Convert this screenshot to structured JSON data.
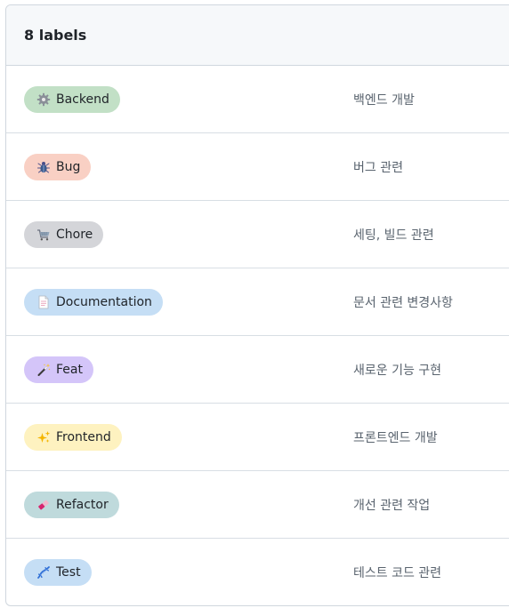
{
  "header": {
    "count_label": "8 labels"
  },
  "labels": [
    {
      "name": "Backend",
      "icon": "gear-icon",
      "color": "#c2e0c6",
      "description": "백엔드 개발"
    },
    {
      "name": "Bug",
      "icon": "bug-icon",
      "color": "#f9d0c4",
      "description": "버그 관련"
    },
    {
      "name": "Chore",
      "icon": "shopping-cart-icon",
      "color": "#d4d5d9",
      "description": "세팅, 빌드 관련"
    },
    {
      "name": "Documentation",
      "icon": "page-icon",
      "color": "#c5def5",
      "description": "문서 관련 변경사항"
    },
    {
      "name": "Feat",
      "icon": "magic-wand-icon",
      "color": "#d4c5f9",
      "description": "새로운 기능 구현"
    },
    {
      "name": "Frontend",
      "icon": "sparkles-icon",
      "color": "#fef2c0",
      "description": "프론트엔드 개발"
    },
    {
      "name": "Refactor",
      "icon": "eraser-icon",
      "color": "#bfdadc",
      "description": "개선 관련 작업"
    },
    {
      "name": "Test",
      "icon": "dna-icon",
      "color": "#c5def5",
      "description": "테스트 코드 관련"
    }
  ]
}
